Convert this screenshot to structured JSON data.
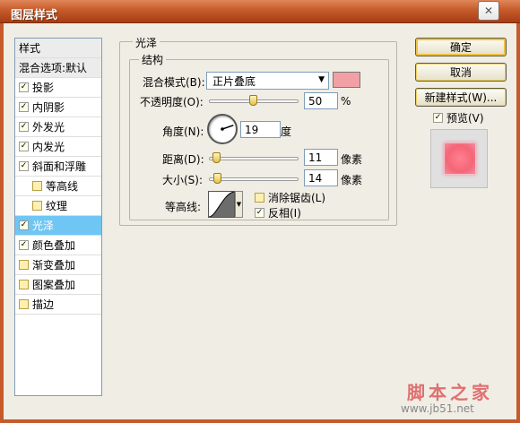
{
  "window": {
    "title": "图层样式",
    "close_glyph": "✕"
  },
  "styles_list": {
    "header": "样式",
    "blend_default": "混合选项:默认",
    "items": [
      {
        "label": "投影",
        "checked": true
      },
      {
        "label": "内阴影",
        "checked": true
      },
      {
        "label": "外发光",
        "checked": true
      },
      {
        "label": "内发光",
        "checked": true
      },
      {
        "label": "斜面和浮雕",
        "checked": true
      },
      {
        "label": "等高线",
        "checked": false
      },
      {
        "label": "纹理",
        "checked": false
      },
      {
        "label": "光泽",
        "checked": true,
        "selected": true
      },
      {
        "label": "颜色叠加",
        "checked": true
      },
      {
        "label": "渐变叠加",
        "checked": false
      },
      {
        "label": "图案叠加",
        "checked": false
      },
      {
        "label": "描边",
        "checked": false
      }
    ]
  },
  "satin": {
    "section_title": "光泽",
    "structure_title": "结构",
    "blend_mode_label": "混合模式(B):",
    "blend_mode_value": "正片叠底",
    "swatch_color": "#f2a0a6",
    "opacity_label": "不透明度(O):",
    "opacity_value": "50",
    "opacity_unit": "%",
    "opacity_fraction": 0.5,
    "angle_label": "角度(N):",
    "angle_value": "19",
    "angle_unit": "度",
    "distance_label": "距离(D):",
    "distance_value": "11",
    "distance_unit": "像素",
    "size_label": "大小(S):",
    "size_value": "14",
    "size_unit": "像素",
    "contour_label": "等高线:",
    "anti_alias_label": "消除锯齿(L)",
    "anti_alias_checked": false,
    "invert_label": "反相(I)",
    "invert_checked": true
  },
  "actions": {
    "ok": "确定",
    "cancel": "取消",
    "new_style": "新建样式(W)...",
    "preview_label": "预览(V)",
    "preview_checked": true
  },
  "watermark": {
    "brand": "脚本之家",
    "url": "www.jb51.net"
  },
  "colors": {
    "titlebar": "#c65a2a",
    "selection": "#6fc6f4",
    "swatch": "#f2a0a6",
    "preview": "#f56677"
  }
}
